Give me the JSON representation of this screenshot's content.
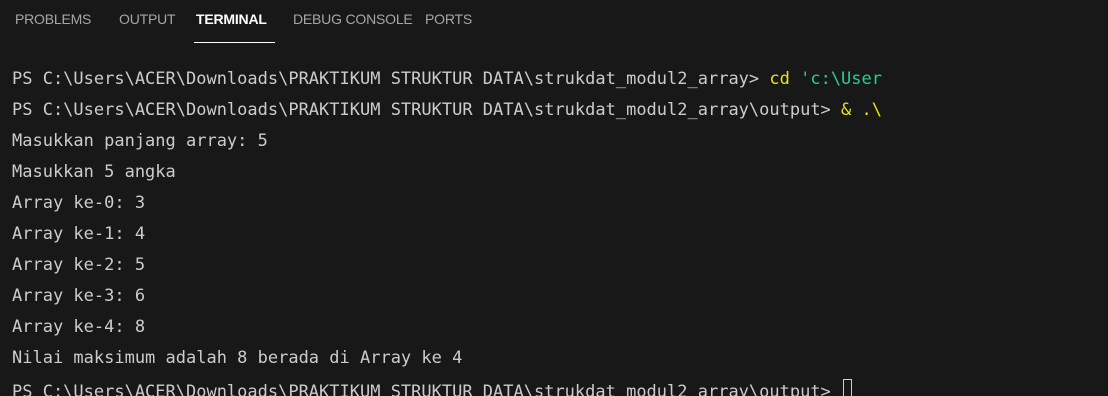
{
  "tabs": [
    {
      "label": "PROBLEMS"
    },
    {
      "label": "OUTPUT"
    },
    {
      "label": "TERMINAL",
      "active": true
    },
    {
      "label": "DEBUG CONSOLE"
    },
    {
      "label": "PORTS"
    }
  ],
  "terminal": {
    "line1_prompt": "PS C:\\Users\\ACER\\Downloads\\PRAKTIKUM STRUKTUR DATA\\strukdat_modul2_array> ",
    "line1_cmd": "cd",
    "line1_arg": " 'c:\\User",
    "line2_prompt": "PS C:\\Users\\ACER\\Downloads\\PRAKTIKUM STRUKTUR DATA\\strukdat_modul2_array\\output> ",
    "line2_cmd": "& .\\",
    "output_lines": [
      "Masukkan panjang array: 5",
      "Masukkan 5 angka",
      "Array ke-0: 3",
      "Array ke-1: 4",
      "Array ke-2: 5",
      "Array ke-3: 6",
      "Array ke-4: 8",
      "Nilai maksimum adalah 8 berada di Array ke 4"
    ],
    "last_prompt": "PS C:\\Users\\ACER\\Downloads\\PRAKTIKUM STRUKTUR DATA\\strukdat_modul2_array\\output> "
  },
  "colors": {
    "background": "#181818",
    "text": "#cccccc",
    "command": "#e5e510",
    "string": "#23d18b",
    "tab_inactive": "#a6a6a6",
    "tab_active": "#ffffff"
  }
}
